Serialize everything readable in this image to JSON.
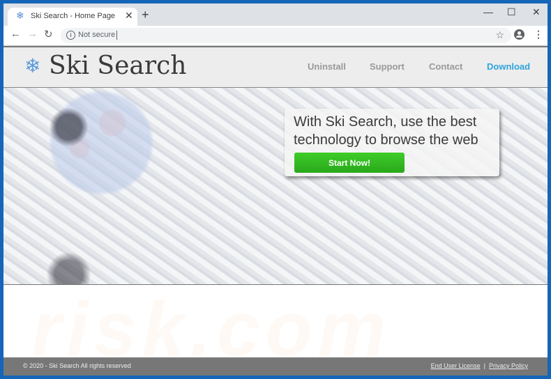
{
  "browser": {
    "tab_title": "Ski Search - Home Page",
    "tab_favicon": "❄",
    "tab_close": "✕",
    "new_tab": "+",
    "window_controls": {
      "minimize": "—",
      "maximize": "☐",
      "close": "✕"
    },
    "nav": {
      "back": "←",
      "forward": "→",
      "reload": "↻"
    },
    "security_label": "Not secure",
    "info_icon": "i",
    "star_icon": "☆",
    "menu_icon": "⋮"
  },
  "site": {
    "logo_icon": "❄",
    "logo_text": "Ski Search",
    "nav": [
      {
        "label": "Uninstall"
      },
      {
        "label": "Support"
      },
      {
        "label": "Contact"
      },
      {
        "label": "Download",
        "active": true
      }
    ],
    "hero": {
      "title": "With Ski Search, use the best technology to browse the web",
      "button": "Start Now!"
    },
    "watermark": "risk.com",
    "footer": {
      "copyright": "© 2020 - Ski Search All rights reserved",
      "links": [
        "End User License",
        "Privacy Policy"
      ],
      "separator": "|"
    }
  },
  "colors": {
    "accent": "#2ea4dc",
    "button_green": "#33b822",
    "footer_bg": "#777777",
    "frame_blue": "#1565b8"
  }
}
